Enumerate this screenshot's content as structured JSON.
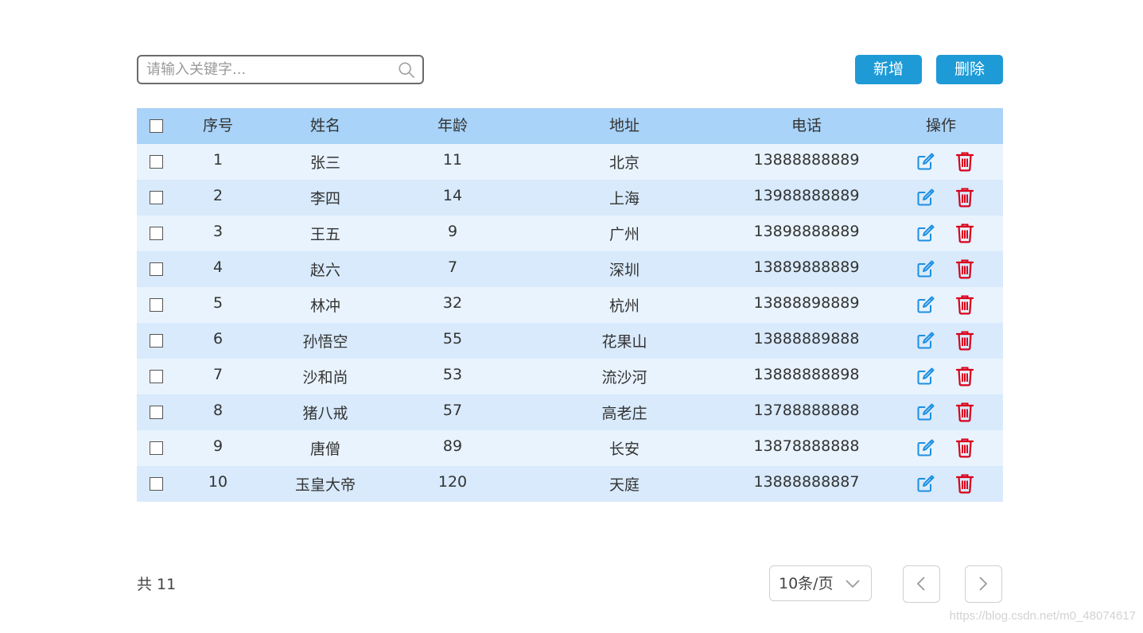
{
  "search": {
    "placeholder": "请输入关键字..."
  },
  "toolbar": {
    "add_label": "新增",
    "delete_label": "删除"
  },
  "table": {
    "headers": {
      "index": "序号",
      "name": "姓名",
      "age": "年龄",
      "address": "地址",
      "phone": "电话",
      "actions": "操作"
    },
    "rows": [
      {
        "index": "1",
        "name": "张三",
        "age": "11",
        "address": "北京",
        "phone": "13888888889"
      },
      {
        "index": "2",
        "name": "李四",
        "age": "14",
        "address": "上海",
        "phone": "13988888889"
      },
      {
        "index": "3",
        "name": "王五",
        "age": "9",
        "address": "广州",
        "phone": "13898888889"
      },
      {
        "index": "4",
        "name": "赵六",
        "age": "7",
        "address": "深圳",
        "phone": "13889888889"
      },
      {
        "index": "5",
        "name": "林冲",
        "age": "32",
        "address": "杭州",
        "phone": "13888898889"
      },
      {
        "index": "6",
        "name": "孙悟空",
        "age": "55",
        "address": "花果山",
        "phone": "13888889888"
      },
      {
        "index": "7",
        "name": "沙和尚",
        "age": "53",
        "address": "流沙河",
        "phone": "13888888898"
      },
      {
        "index": "8",
        "name": "猪八戒",
        "age": "57",
        "address": "高老庄",
        "phone": "13788888888"
      },
      {
        "index": "9",
        "name": "唐僧",
        "age": "89",
        "address": "长安",
        "phone": "13878888888"
      },
      {
        "index": "10",
        "name": "玉皇大帝",
        "age": "120",
        "address": "天庭",
        "phone": "13888888887"
      }
    ]
  },
  "footer": {
    "total_label": "共 11",
    "page_size_label": "10条/页"
  },
  "watermark": "https://blog.csdn.net/m0_48074617",
  "icons": {
    "search": "search-icon",
    "edit": "edit-icon",
    "delete": "trash-icon",
    "dropdown": "chevron-down-icon",
    "prev": "chevron-left-icon",
    "next": "chevron-right-icon"
  },
  "colors": {
    "primary_button": "#1e9ad6",
    "table_header": "#a9d3f8",
    "row_odd": "#e8f3fd",
    "row_even": "#d8eafc",
    "edit_icon": "#1e8fe1",
    "delete_icon": "#d9001b"
  }
}
